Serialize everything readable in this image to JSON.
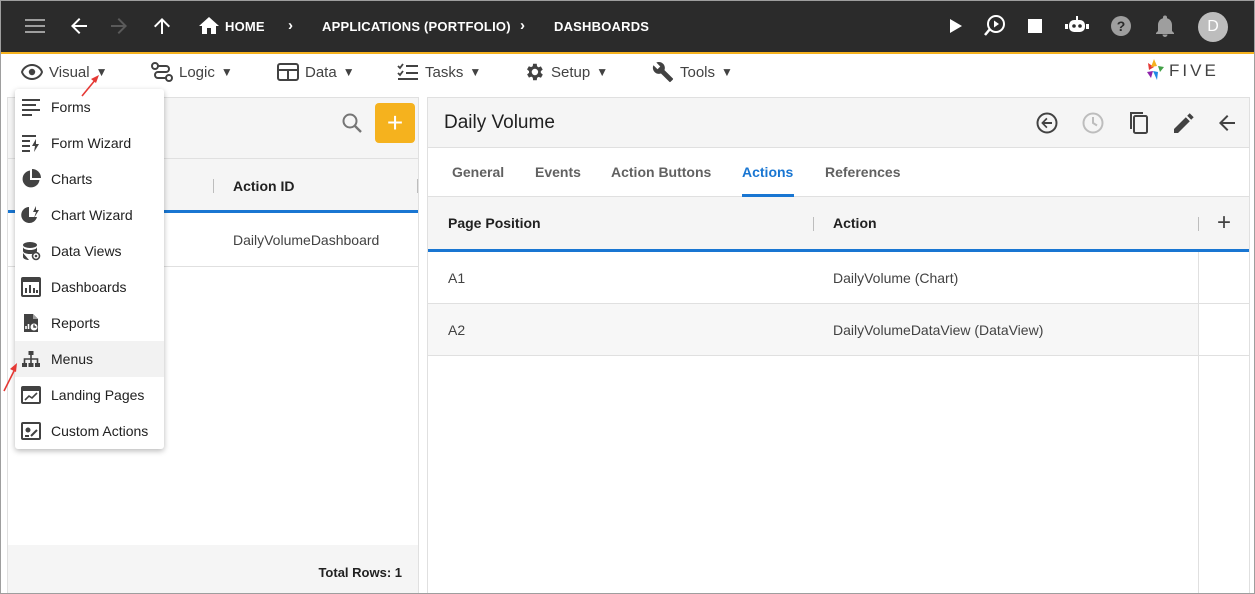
{
  "topbar": {
    "breadcrumbs": [
      "HOME",
      "APPLICATIONS (PORTFOLIO)",
      "DASHBOARDS"
    ],
    "avatar_letter": "D",
    "icons": [
      "menu-icon",
      "back-arrow-icon",
      "forward-arrow-icon",
      "up-arrow-icon",
      "home-icon",
      "play-icon",
      "preview-icon",
      "stop-icon",
      "bot-icon",
      "help-icon",
      "bell-icon"
    ]
  },
  "toolbar": {
    "menus": [
      {
        "label": "Visual",
        "icon": "eye-icon"
      },
      {
        "label": "Logic",
        "icon": "logic-icon"
      },
      {
        "label": "Data",
        "icon": "table-icon"
      },
      {
        "label": "Tasks",
        "icon": "tasks-icon"
      },
      {
        "label": "Setup",
        "icon": "gear-icon"
      },
      {
        "label": "Tools",
        "icon": "tools-icon"
      }
    ],
    "logo_text": "FIVE"
  },
  "visual_menu": {
    "items": [
      {
        "label": "Forms",
        "icon": "forms-icon"
      },
      {
        "label": "Form Wizard",
        "icon": "form-wizard-icon"
      },
      {
        "label": "Charts",
        "icon": "pie-chart-icon"
      },
      {
        "label": "Chart Wizard",
        "icon": "chart-wizard-icon"
      },
      {
        "label": "Data Views",
        "icon": "data-views-icon"
      },
      {
        "label": "Dashboards",
        "icon": "dashboard-icon"
      },
      {
        "label": "Reports",
        "icon": "reports-icon"
      },
      {
        "label": "Menus",
        "icon": "menus-icon"
      },
      {
        "label": "Landing Pages",
        "icon": "landing-pages-icon"
      },
      {
        "label": "Custom Actions",
        "icon": "custom-actions-icon"
      }
    ]
  },
  "left_list": {
    "column": "Action ID",
    "rows": [
      "DailyVolumeDashboard"
    ],
    "footer": "Total Rows: 1"
  },
  "detail": {
    "title": "Daily Volume",
    "tabs": [
      "General",
      "Events",
      "Action Buttons",
      "Actions",
      "References"
    ],
    "active_tab": "Actions",
    "grid": {
      "columns": [
        "Page Position",
        "Action"
      ],
      "rows": [
        {
          "position": "A1",
          "action": "DailyVolume (Chart)"
        },
        {
          "position": "A2",
          "action": "DailyVolumeDataView (DataView)"
        }
      ]
    }
  },
  "colors": {
    "topbar": "#2b2b2b",
    "accent": "#f5b21e",
    "primary": "#1976d2",
    "annotation_arrow": "#e53935"
  }
}
